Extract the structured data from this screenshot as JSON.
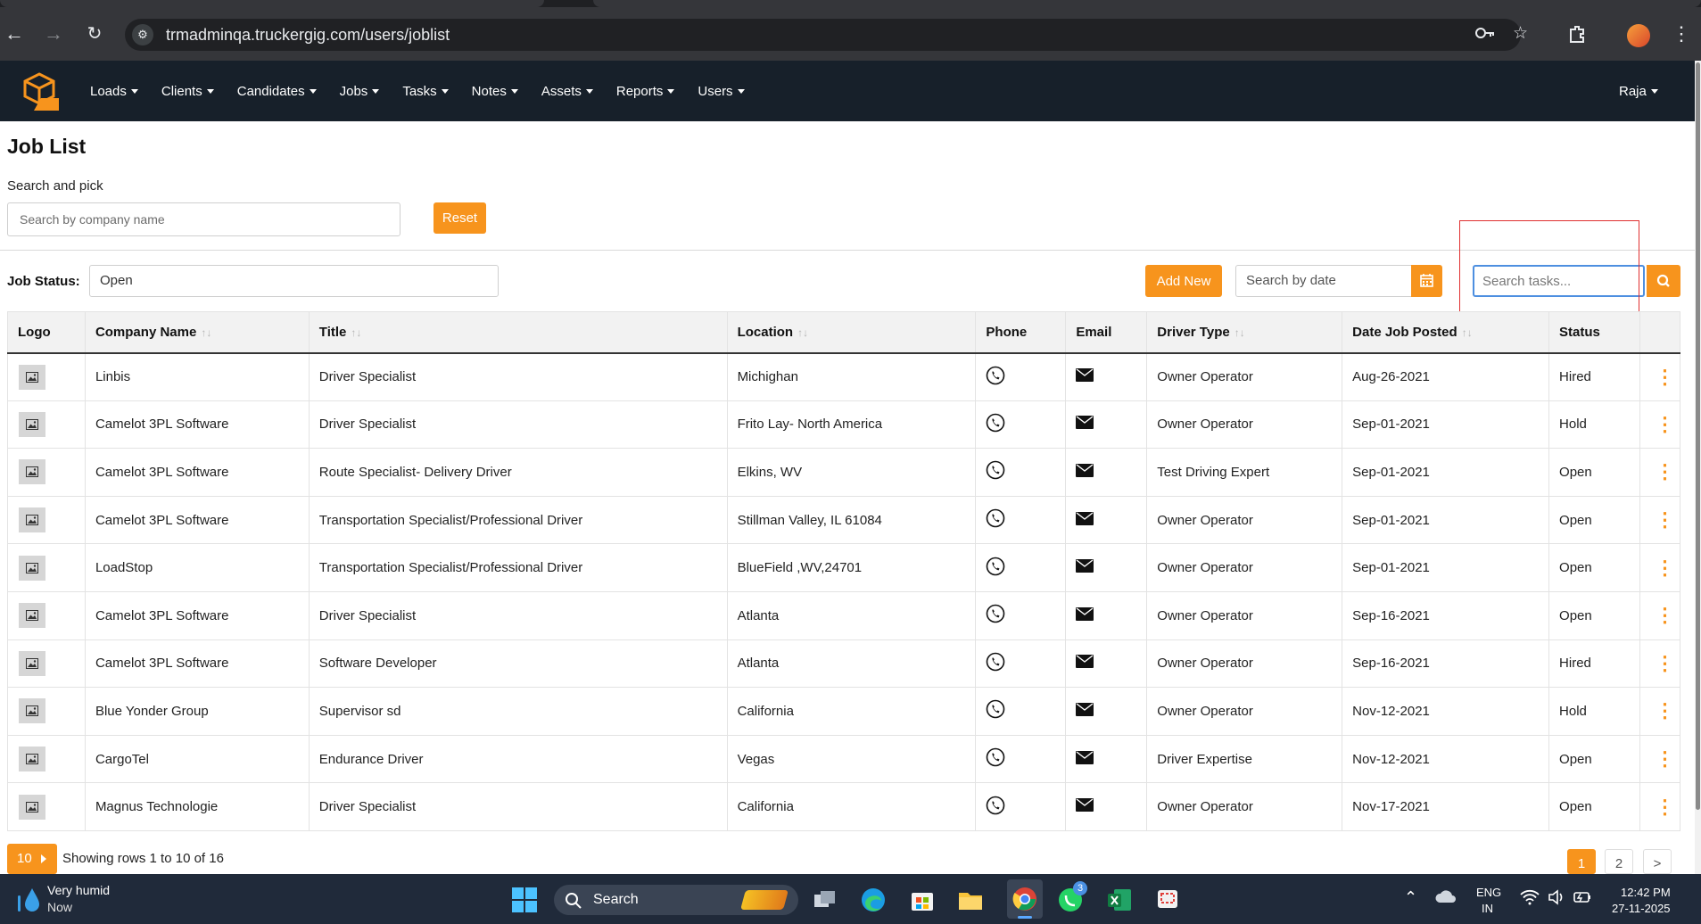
{
  "browser": {
    "url": "trmadminqa.truckergig.com/users/joblist"
  },
  "nav": {
    "menu": [
      "Loads",
      "Clients",
      "Candidates",
      "Jobs",
      "Tasks",
      "Notes",
      "Assets",
      "Reports",
      "Users"
    ],
    "user": "Raja"
  },
  "page": {
    "title": "Job List",
    "search_label": "Search and pick",
    "company_search_placeholder": "Search by company name",
    "reset_label": "Reset",
    "job_status_label": "Job Status:",
    "job_status_value": "Open",
    "add_new_label": "Add New",
    "date_placeholder": "Search by date",
    "task_search_placeholder": "Search tasks..."
  },
  "table": {
    "headers": [
      "Logo",
      "Company Name",
      "Title",
      "Location",
      "Phone",
      "Email",
      "Driver Type",
      "Date Job Posted",
      "Status"
    ],
    "rows": [
      {
        "company": "Linbis",
        "title": "Driver Specialist",
        "location": "Michighan",
        "driver_type": "Owner Operator",
        "date": "Aug-26-2021",
        "status": "Hired"
      },
      {
        "company": "Camelot 3PL Software",
        "title": "Driver Specialist",
        "location": "Frito Lay- North America",
        "driver_type": "Owner Operator",
        "date": "Sep-01-2021",
        "status": "Hold"
      },
      {
        "company": "Camelot 3PL Software",
        "title": "Route Specialist- Delivery Driver",
        "location": "Elkins, WV",
        "driver_type": "Test Driving Expert",
        "date": "Sep-01-2021",
        "status": "Open"
      },
      {
        "company": "Camelot 3PL Software",
        "title": "Transportation Specialist/Professional Driver",
        "location": "Stillman Valley, IL 61084",
        "driver_type": "Owner Operator",
        "date": "Sep-01-2021",
        "status": "Open"
      },
      {
        "company": "LoadStop",
        "title": "Transportation Specialist/Professional Driver",
        "location": "BlueField ,WV,24701",
        "driver_type": "Owner Operator",
        "date": "Sep-01-2021",
        "status": "Open"
      },
      {
        "company": "Camelot 3PL Software",
        "title": "Driver Specialist",
        "location": "Atlanta",
        "driver_type": "Owner Operator",
        "date": "Sep-16-2021",
        "status": "Open"
      },
      {
        "company": "Camelot 3PL Software",
        "title": "Software Developer",
        "location": "Atlanta",
        "driver_type": "Owner Operator",
        "date": "Sep-16-2021",
        "status": "Hired"
      },
      {
        "company": "Blue Yonder Group",
        "title": "Supervisor sd",
        "location": "California",
        "driver_type": "Owner Operator",
        "date": "Nov-12-2021",
        "status": "Hold"
      },
      {
        "company": "CargoTel",
        "title": "Endurance Driver",
        "location": "Vegas",
        "driver_type": "Driver Expertise",
        "date": "Nov-12-2021",
        "status": "Open"
      },
      {
        "company": "Magnus Technologie",
        "title": "Driver Specialist",
        "location": "California",
        "driver_type": "Owner Operator",
        "date": "Nov-17-2021",
        "status": "Open"
      }
    ]
  },
  "footer": {
    "page_size": "10",
    "showing": "Showing rows 1 to 10 of 16",
    "pages": [
      "1",
      "2",
      ">"
    ]
  },
  "taskbar": {
    "weather_title": "Very humid",
    "weather_sub": "Now",
    "search": "Search",
    "whatsapp_badge": "3",
    "lang1": "ENG",
    "lang2": "IN",
    "time": "12:42 PM",
    "date": "27-11-2025"
  },
  "colors": {
    "accent": "#f7941d",
    "navbar": "#17202a",
    "focus": "#4d8fe0",
    "highlight_box": "#e03030"
  }
}
